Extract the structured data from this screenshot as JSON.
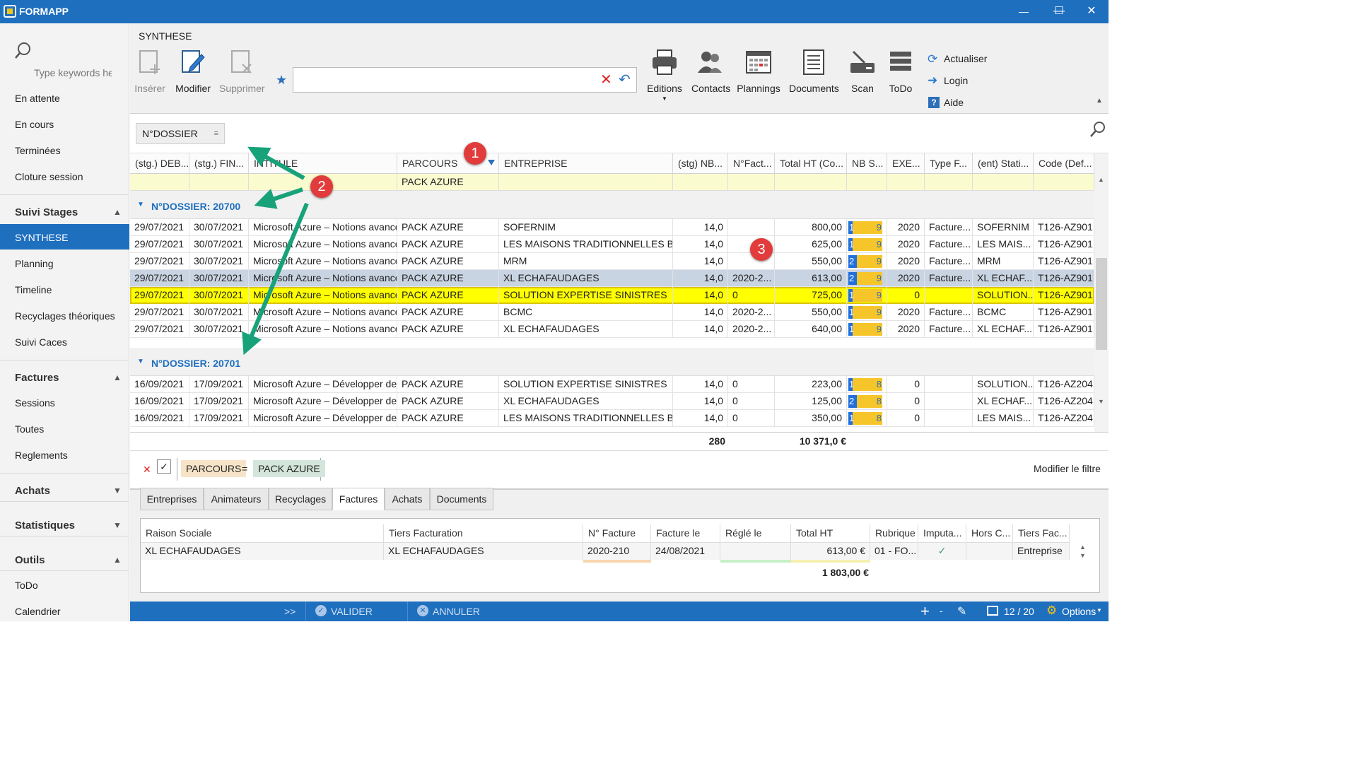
{
  "app": {
    "title": "FORMAPP"
  },
  "window": {
    "minimize": "—",
    "maximize": "☐",
    "close": "✕"
  },
  "sidebar": {
    "search_placeholder": "Type keywords he",
    "items_top": [
      "En attente",
      "En cours",
      "Terminées",
      "Cloture session"
    ],
    "sections": [
      {
        "title": "Suivi Stages",
        "items": [
          "SYNTHESE",
          "Planning",
          "Timeline",
          "Recyclages théoriques",
          "Suivi Caces"
        ]
      },
      {
        "title": "Factures",
        "items": [
          "Sessions",
          "Toutes",
          "Reglements"
        ]
      },
      {
        "title": "Achats",
        "items": []
      },
      {
        "title": "Statistiques",
        "items": []
      },
      {
        "title": "Outils",
        "items": [
          "ToDo",
          "Calendrier"
        ]
      }
    ],
    "active_item": "SYNTHESE"
  },
  "page": {
    "title": "SYNTHESE"
  },
  "toolbar": {
    "insert_label": "Insérer",
    "modify_label": "Modifier",
    "delete_label": "Supprimer",
    "editions_label": "Editions",
    "contacts_label": "Contacts",
    "plannings_label": "Plannings",
    "documents_label": "Documents",
    "scan_label": "Scan",
    "todo_label": "ToDo",
    "refresh_label": "Actualiser",
    "login_label": "Login",
    "help_label": "Aide",
    "filter_value": ""
  },
  "grouping": {
    "chip": "N°DOSSIER"
  },
  "grid": {
    "columns": [
      "(stg.) DEB...",
      "(stg.) FIN...",
      "INTITULE",
      "PARCOURS",
      "ENTREPRISE",
      "(stg) NB...",
      "N°Fact...",
      "Total HT (Co...",
      "NB S...",
      "EXE...",
      "Type F...",
      "(ent) Stati...",
      "Code (Def..."
    ],
    "filter_row_parcours": "PACK AZURE",
    "groups": [
      {
        "label": "N°DOSSIER: 20700",
        "rows": [
          {
            "deb": "29/07/2021",
            "fin": "30/07/2021",
            "intitule": "Microsoft Azure – Notions avancé...",
            "parcours": "PACK AZURE",
            "entreprise": "SOFERNIM",
            "nb": "14,0",
            "nfact": "",
            "total": "800,00",
            "nbs_a": "1",
            "nbs_b": "9",
            "exe": "2020",
            "type": "Facture...",
            "stat": "SOFERNIM",
            "code": "T126-AZ901"
          },
          {
            "deb": "29/07/2021",
            "fin": "30/07/2021",
            "intitule": "Microsoft Azure – Notions avancé...",
            "parcours": "PACK AZURE",
            "entreprise": "LES MAISONS TRADITIONNELLES B...",
            "nb": "14,0",
            "nfact": "",
            "total": "625,00",
            "nbs_a": "1",
            "nbs_b": "9",
            "exe": "2020",
            "type": "Facture...",
            "stat": "LES MAIS...",
            "code": "T126-AZ901"
          },
          {
            "deb": "29/07/2021",
            "fin": "30/07/2021",
            "intitule": "Microsoft Azure – Notions avancé...",
            "parcours": "PACK AZURE",
            "entreprise": "MRM",
            "nb": "14,0",
            "nfact": "",
            "total": "550,00",
            "nbs_a": "2",
            "nbs_b": "9",
            "exe": "2020",
            "type": "Facture...",
            "stat": "MRM",
            "code": "T126-AZ901"
          },
          {
            "deb": "29/07/2021",
            "fin": "30/07/2021",
            "intitule": "Microsoft Azure – Notions avancé...",
            "parcours": "PACK AZURE",
            "entreprise": "XL ECHAFAUDAGES",
            "nb": "14,0",
            "nfact": "2020-2...",
            "total": "613,00",
            "nbs_a": "2",
            "nbs_b": "9",
            "exe": "2020",
            "type": "Facture...",
            "stat": "XL ECHAF...",
            "code": "T126-AZ901"
          },
          {
            "deb": "29/07/2021",
            "fin": "30/07/2021",
            "intitule": "Microsoft Azure – Notions avancé...",
            "parcours": "PACK AZURE",
            "entreprise": "SOLUTION EXPERTISE SINISTRES",
            "nb": "14,0",
            "nfact": "0",
            "total": "725,00",
            "nbs_a": "1",
            "nbs_b": "9",
            "exe": "0",
            "type": "",
            "stat": "SOLUTION...",
            "code": "T126-AZ901"
          },
          {
            "deb": "29/07/2021",
            "fin": "30/07/2021",
            "intitule": "Microsoft Azure – Notions avancé...",
            "parcours": "PACK AZURE",
            "entreprise": "BCMC",
            "nb": "14,0",
            "nfact": "2020-2...",
            "total": "550,00",
            "nbs_a": "1",
            "nbs_b": "9",
            "exe": "2020",
            "type": "Facture...",
            "stat": "BCMC",
            "code": "T126-AZ901"
          },
          {
            "deb": "29/07/2021",
            "fin": "30/07/2021",
            "intitule": "Microsoft Azure – Notions avancé...",
            "parcours": "PACK AZURE",
            "entreprise": "XL ECHAFAUDAGES",
            "nb": "14,0",
            "nfact": "2020-2...",
            "total": "640,00",
            "nbs_a": "1",
            "nbs_b": "9",
            "exe": "2020",
            "type": "Facture...",
            "stat": "XL ECHAF...",
            "code": "T126-AZ901"
          }
        ]
      },
      {
        "label": "N°DOSSIER: 20701",
        "rows": [
          {
            "deb": "16/09/2021",
            "fin": "17/09/2021",
            "intitule": "Microsoft Azure – Développer de...",
            "parcours": "PACK AZURE",
            "entreprise": "SOLUTION EXPERTISE SINISTRES",
            "nb": "14,0",
            "nfact": "0",
            "total": "223,00",
            "nbs_a": "1",
            "nbs_b": "8",
            "exe": "0",
            "type": "",
            "stat": "SOLUTION...",
            "code": "T126-AZ204"
          },
          {
            "deb": "16/09/2021",
            "fin": "17/09/2021",
            "intitule": "Microsoft Azure – Développer de...",
            "parcours": "PACK AZURE",
            "entreprise": "XL ECHAFAUDAGES",
            "nb": "14,0",
            "nfact": "0",
            "total": "125,00",
            "nbs_a": "2",
            "nbs_b": "8",
            "exe": "0",
            "type": "",
            "stat": "XL ECHAF...",
            "code": "T126-AZ204"
          },
          {
            "deb": "16/09/2021",
            "fin": "17/09/2021",
            "intitule": "Microsoft Azure – Développer de...",
            "parcours": "PACK AZURE",
            "entreprise": "LES MAISONS TRADITIONNELLES B...",
            "nb": "14,0",
            "nfact": "0",
            "total": "350,00",
            "nbs_a": "1",
            "nbs_b": "8",
            "exe": "0",
            "type": "",
            "stat": "LES MAIS...",
            "code": "T126-AZ204"
          }
        ]
      }
    ],
    "totals": {
      "nb": "280",
      "total": "10 371,0 €"
    }
  },
  "active_filter": {
    "field": "PARCOURS",
    "operator": "=",
    "value": "PACK AZURE",
    "edit_label": "Modifier le filtre"
  },
  "detail_tabs": [
    "Entreprises",
    "Animateurs",
    "Recyclages",
    "Factures",
    "Achats",
    "Documents"
  ],
  "detail_active_tab": "Factures",
  "invoice_grid": {
    "columns": [
      "Raison Sociale",
      "Tiers Facturation",
      "N° Facture",
      "Facture le",
      "Réglé le",
      "Total HT",
      "Rubrique",
      "Imputa...",
      "Hors C...",
      "Tiers Fac..."
    ],
    "row": {
      "raison": "XL ECHAFAUDAGES",
      "tiers": "XL ECHAFAUDAGES",
      "numero": "2020-210",
      "date": "24/08/2021",
      "regle": "",
      "total": "613,00 €",
      "rubrique": "01 - FO...",
      "imputa": "✓",
      "hors": "",
      "tiersfac": "Entreprise"
    },
    "total": "1 803,00 €"
  },
  "statusbar": {
    "expand": ">>",
    "validate": "VALIDER",
    "cancel": "ANNULER",
    "page": "12 / 20",
    "options": "Options"
  },
  "annotations": [
    "1",
    "2",
    "3"
  ],
  "colors": {
    "brand": "#1f6fbf",
    "highlight": "#ffff00",
    "filter_row": "#fbfbd0",
    "arrow": "#18a27a",
    "badge": "#e23b3b"
  }
}
